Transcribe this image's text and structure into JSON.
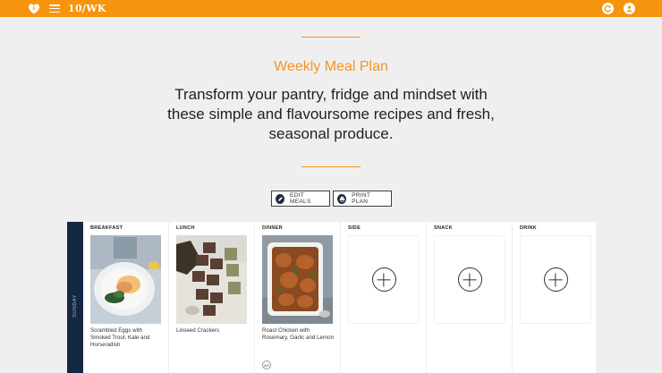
{
  "header": {
    "brand": "10/WK",
    "logo_icon": "heart-logo-icon",
    "menu_icon": "hamburger-menu-icon",
    "right_icons": [
      "refresh-icon",
      "profile-icon"
    ],
    "accent_color": "#f6940e"
  },
  "hero": {
    "title": "Weekly Meal Plan",
    "intro": "Transform your pantry, fridge and mindset with these simple and flavoursome recipes and fresh, seasonal produce."
  },
  "actions": {
    "edit_label": "EDIT MEALS",
    "print_label": "PRINT PLAN"
  },
  "plan": {
    "day": "SUNDAY",
    "columns": [
      {
        "heading": "BREAKFAST",
        "meal": "Scrambled Eggs with Smoked Trout, Kale and Horseradish"
      },
      {
        "heading": "LUNCH",
        "meal": "Linseed Crackers"
      },
      {
        "heading": "DINNER",
        "meal": "Roast Chicken with Rosemary, Garlic and Lemon",
        "badge": "AIP"
      },
      {
        "heading": "SIDE"
      },
      {
        "heading": "SNACK"
      },
      {
        "heading": "DRINK"
      }
    ]
  }
}
